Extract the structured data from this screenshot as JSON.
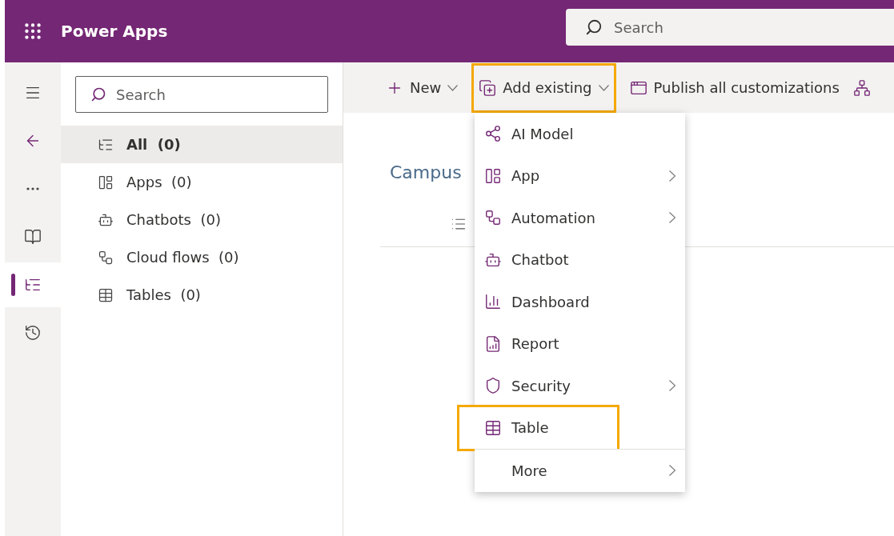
{
  "header": {
    "title": "Power Apps",
    "search": {
      "placeholder": "Search"
    }
  },
  "rail": [
    {
      "selected": false
    },
    {
      "selected": false
    },
    {
      "selected": false
    },
    {
      "selected": false
    },
    {
      "selected": true
    },
    {
      "selected": false
    }
  ],
  "sidebar": {
    "search": {
      "placeholder": "Search"
    },
    "items": [
      {
        "label": "All",
        "count": "(0)",
        "selected": true
      },
      {
        "label": "Apps",
        "count": "(0)",
        "selected": false
      },
      {
        "label": "Chatbots",
        "count": "(0)",
        "selected": false
      },
      {
        "label": "Cloud flows",
        "count": "(0)",
        "selected": false
      },
      {
        "label": "Tables",
        "count": "(0)",
        "selected": false
      }
    ]
  },
  "toolbar": [
    {
      "label": "New",
      "dropdown": true,
      "highlighted": false
    },
    {
      "label": "Add existing",
      "dropdown": true,
      "highlighted": true
    },
    {
      "label": "Publish all customizations",
      "dropdown": false,
      "highlighted": false
    }
  ],
  "content": {
    "title": "Campus"
  },
  "menu": [
    {
      "label": "AI Model",
      "submenu": false,
      "highlighted": false
    },
    {
      "label": "App",
      "submenu": true,
      "highlighted": false
    },
    {
      "label": "Automation",
      "submenu": true,
      "highlighted": false
    },
    {
      "label": "Chatbot",
      "submenu": false,
      "highlighted": false
    },
    {
      "label": "Dashboard",
      "submenu": false,
      "highlighted": false
    },
    {
      "label": "Report",
      "submenu": false,
      "highlighted": false
    },
    {
      "label": "Security",
      "submenu": true,
      "highlighted": false
    },
    {
      "label": "Table",
      "submenu": false,
      "highlighted": true
    },
    {
      "label": "More",
      "submenu": true,
      "highlighted": false
    }
  ]
}
